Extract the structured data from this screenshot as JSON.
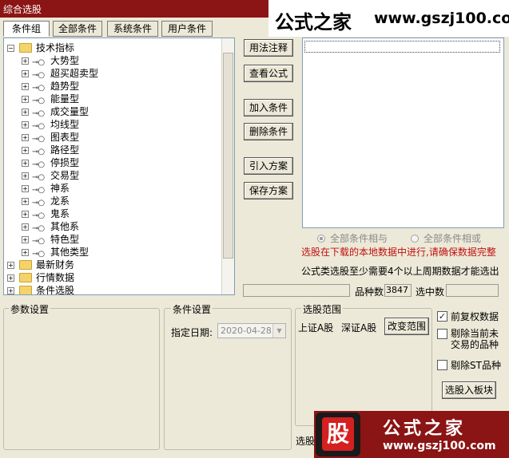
{
  "window": {
    "title": "综合选股"
  },
  "watermark": {
    "name": "公式之家",
    "url": "www.gszj100.com",
    "badge_char": "股"
  },
  "tabs": [
    "条件组",
    "全部条件",
    "系统条件",
    "用户条件"
  ],
  "tree": {
    "root": "技术指标",
    "children": [
      "大势型",
      "超买超卖型",
      "趋势型",
      "能量型",
      "成交量型",
      "均线型",
      "图表型",
      "路径型",
      "停损型",
      "交易型",
      "神系",
      "龙系",
      "鬼系",
      "其他系",
      "特色型",
      "其他类型"
    ],
    "siblings": [
      "最新财务",
      "行情数据",
      "条件选股"
    ]
  },
  "buttons": {
    "usage_note": "用法注释",
    "view_formula": "查看公式",
    "add_condition": "加入条件",
    "delete_condition": "删除条件",
    "import_scheme": "引入方案",
    "save_scheme": "保存方案",
    "change_range": "改变范围",
    "select_to_block": "选股入板块"
  },
  "logic": {
    "and_label": "全部条件相与",
    "or_label": "全部条件相或",
    "selected": "and"
  },
  "notes": {
    "warning": "选股在下载的本地数据中进行,请确保数据完整",
    "requirement": "公式类选股至少需要4个以上周期数据才能选出"
  },
  "stats": {
    "variety_label": "品种数",
    "variety_value": "3847",
    "selected_label": "选中数",
    "selected_value": ""
  },
  "groups": {
    "params": "参数设置",
    "condition": "条件设置",
    "range": "选股范围"
  },
  "condition_setting": {
    "date_label": "指定日期:",
    "date_value": "2020-04-28"
  },
  "range": {
    "sh": "上证A股",
    "sz": "深证A股"
  },
  "options": [
    {
      "label": "前复权数据",
      "checked": true
    },
    {
      "label": "剔除当前未交易的品种",
      "checked": false
    },
    {
      "label": "剔除ST品种",
      "checked": false
    }
  ],
  "bottom_label": "选股"
}
